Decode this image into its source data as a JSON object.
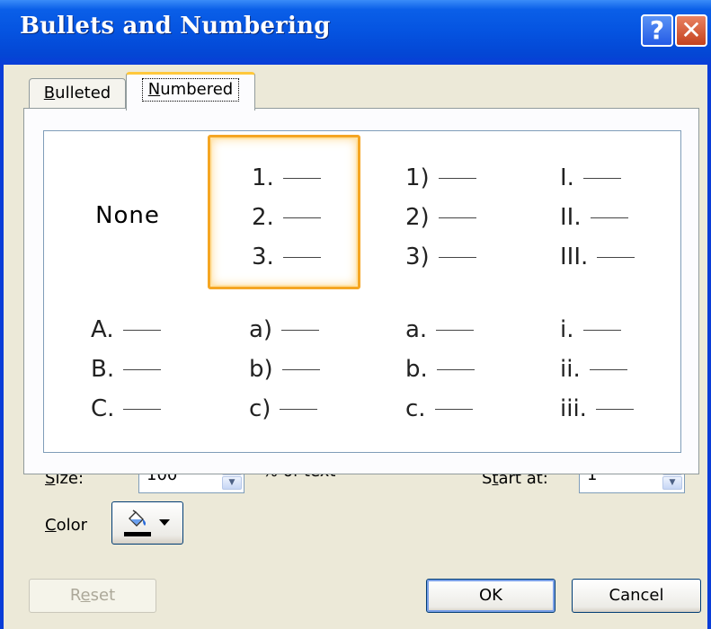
{
  "window": {
    "title": "Bullets and Numbering",
    "help_glyph": "?",
    "close_glyph": "✕"
  },
  "tabs": [
    {
      "label_key": "B",
      "label_rest": "ulleted",
      "selected": false
    },
    {
      "label_key": "N",
      "label_rest": "umbered",
      "selected": true
    }
  ],
  "gallery": {
    "none_label": "None",
    "selected_index": 1,
    "styles": [
      [
        "1.",
        "2.",
        "3."
      ],
      [
        "1)",
        "2)",
        "3)"
      ],
      [
        "I.",
        "II.",
        "III."
      ],
      [
        "A.",
        "B.",
        "C."
      ],
      [
        "a)",
        "b)",
        "c)"
      ],
      [
        "a.",
        "b.",
        "c."
      ],
      [
        "i.",
        "ii.",
        "iii."
      ]
    ]
  },
  "size": {
    "label_key": "S",
    "label_rest": "ize:",
    "value": "100",
    "suffix": "% of text"
  },
  "start_at": {
    "label_pre": "S",
    "label_key": "t",
    "label_rest": "art at:",
    "value": "1"
  },
  "color": {
    "label_key": "C",
    "label_rest": "olor",
    "current_color": "#000000",
    "icon": "paint-bucket-icon"
  },
  "buttons": {
    "reset_pre": "R",
    "reset_key": "e",
    "reset_rest": "set",
    "ok": "OK",
    "cancel": "Cancel"
  },
  "colors": {
    "title_bar": "#0553e0",
    "dialog_bg": "#ece9d8",
    "selected_border": "#f5a623",
    "tab_highlight": "#ffc83c"
  }
}
